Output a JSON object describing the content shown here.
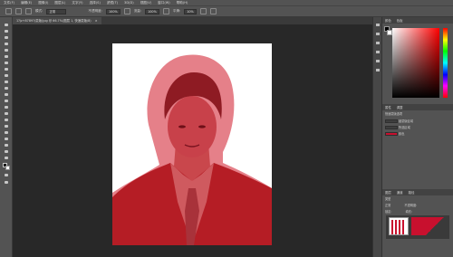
{
  "menubar": {
    "items": [
      "文件(F)",
      "编辑(E)",
      "图像(I)",
      "图层(L)",
      "文字(Y)",
      "选择(S)",
      "滤镜(T)",
      "3D(D)",
      "视图(V)",
      "窗口(W)",
      "帮助(H)"
    ]
  },
  "options": {
    "mode_label": "模式:",
    "mode_value": "正常",
    "opacity_label": "不透明度:",
    "opacity_value": "100%",
    "flow_label": "流量:",
    "flow_value": "100%",
    "smooth_label": "平滑:",
    "smooth_value": "10%"
  },
  "document": {
    "tab_title": "1?jz+8789?(蒙版)jpg @ 66.7%(图层 1, 快速蒙版/8)"
  },
  "colors": {
    "mask_red": "#c8102e",
    "panel_bg": "#535353",
    "canvas_bg": "#282828"
  },
  "panels": {
    "color_tabs": [
      "颜色",
      "色板"
    ],
    "props_tabs": [
      "属性",
      "调整"
    ],
    "props_title": "快速蒙版选项",
    "props_rows": [
      "被蒙版区域",
      "所选区域",
      "颜色"
    ],
    "layers_tabs": [
      "图层",
      "通道",
      "路径"
    ],
    "layers_kind": "类型",
    "layers_mode": "正常",
    "layers_opacity_label": "不透明度:",
    "layers_lock_label": "锁定:",
    "layers_fill_label": "填充:"
  }
}
